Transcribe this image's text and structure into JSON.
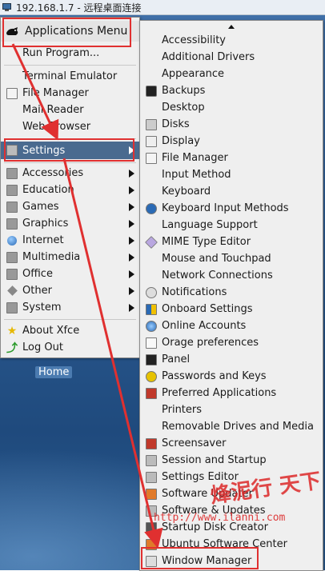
{
  "titlebar": {
    "title": "192.168.1.7 - 远程桌面连接"
  },
  "desktop": {
    "home_label": "Home"
  },
  "left_menu": {
    "header": "Applications Menu",
    "items": [
      {
        "label": "Run Program...",
        "icon": "none"
      },
      {
        "label": "Terminal Emulator",
        "icon": "none"
      },
      {
        "label": "File Manager",
        "icon": "file-manager-icon"
      },
      {
        "label": "Mail Reader",
        "icon": "none"
      },
      {
        "label": "Web Browser",
        "icon": "none"
      },
      {
        "label": "Settings",
        "icon": "settings-icon",
        "submenu": true,
        "selected": true
      },
      {
        "label": "Accessories",
        "icon": "accessories-icon",
        "submenu": true
      },
      {
        "label": "Education",
        "icon": "education-icon",
        "submenu": true
      },
      {
        "label": "Games",
        "icon": "games-icon",
        "submenu": true
      },
      {
        "label": "Graphics",
        "icon": "graphics-icon",
        "submenu": true
      },
      {
        "label": "Internet",
        "icon": "internet-icon",
        "submenu": true
      },
      {
        "label": "Multimedia",
        "icon": "multimedia-icon",
        "submenu": true
      },
      {
        "label": "Office",
        "icon": "office-icon",
        "submenu": true
      },
      {
        "label": "Other",
        "icon": "other-icon",
        "submenu": true
      },
      {
        "label": "System",
        "icon": "system-icon",
        "submenu": true
      },
      {
        "label": "About Xfce",
        "icon": "star-icon"
      },
      {
        "label": "Log Out",
        "icon": "logout-icon"
      }
    ]
  },
  "settings_menu": {
    "items": [
      "Accessibility",
      "Additional Drivers",
      "Appearance",
      "Backups",
      "Desktop",
      "Disks",
      "Display",
      "File Manager",
      "Input Method",
      "Keyboard",
      "Keyboard Input Methods",
      "Language Support",
      "MIME Type Editor",
      "Mouse and Touchpad",
      "Network Connections",
      "Notifications",
      "Onboard Settings",
      "Online Accounts",
      "Orage preferences",
      "Panel",
      "Passwords and Keys",
      "Preferred Applications",
      "Printers",
      "Removable Drives and Media",
      "Screensaver",
      "Session and Startup",
      "Settings Editor",
      "Software Updater",
      "Software & Updates",
      "Startup Disk Creator",
      "Ubuntu Software Center",
      "Window Manager"
    ]
  },
  "watermark": {
    "line1": "烽泥行 天下",
    "line2": "http://www.ilanni.com"
  },
  "colors": {
    "selected_bg": "#4a6a8f",
    "annotation": "#e03030",
    "desktop": "#2d5d94"
  }
}
